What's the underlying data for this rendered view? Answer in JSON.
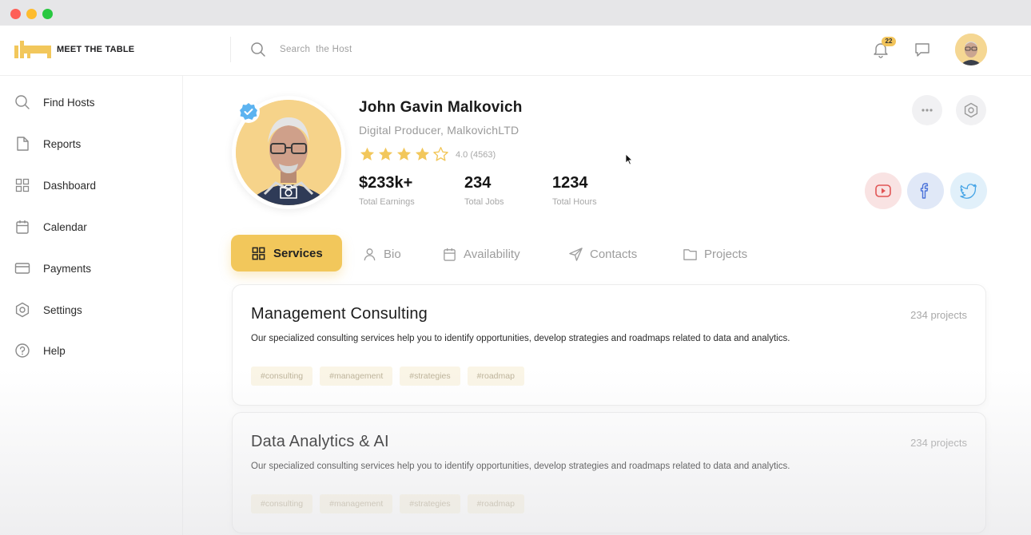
{
  "app": {
    "name": "MEET THE TABLE"
  },
  "search": {
    "placeholder": "Search  the Host"
  },
  "notifications": {
    "count": "22"
  },
  "sidebar": {
    "items": [
      {
        "label": "Find Hosts",
        "icon": "search-icon"
      },
      {
        "label": "Reports",
        "icon": "document-icon"
      },
      {
        "label": "Dashboard",
        "icon": "grid-icon"
      },
      {
        "label": "Calendar",
        "icon": "calendar-icon"
      },
      {
        "label": "Payments",
        "icon": "card-icon"
      },
      {
        "label": "Settings",
        "icon": "gear-icon"
      },
      {
        "label": "Help",
        "icon": "help-icon"
      }
    ]
  },
  "profile": {
    "name": "John Gavin Malkovich",
    "role": "Digital Producer, MalkovichLTD",
    "rating": 4.0,
    "rating_text": "4.0 (4563)",
    "stats": [
      {
        "value": "$233k+",
        "label": "Total Earnings"
      },
      {
        "value": "234",
        "label": "Total Jobs"
      },
      {
        "value": "1234",
        "label": "Total Hours"
      }
    ]
  },
  "colors": {
    "accent": "#f2c75b",
    "youtube": "#f9e3e3",
    "facebook": "#e0e8f7",
    "twitter": "#e1f0fa"
  },
  "tabs": [
    {
      "label": "Services",
      "icon": "grid-icon",
      "active": true
    },
    {
      "label": "Bio",
      "icon": "user-icon"
    },
    {
      "label": "Availability",
      "icon": "calendar-icon"
    },
    {
      "label": "Contacts",
      "icon": "send-icon"
    },
    {
      "label": "Projects",
      "icon": "folder-icon"
    }
  ],
  "services": [
    {
      "title": "Management Consulting",
      "count": "234 projects",
      "description": "Our specialized consulting services help you to identify opportunities, develop strategies and roadmaps related to data and analytics.",
      "tags": [
        "#consulting",
        "#management",
        "#strategies",
        "#roadmap"
      ]
    },
    {
      "title": "Data Analytics & AI",
      "count": "234 projects",
      "description": "Our specialized consulting services help you to identify opportunities, develop strategies and roadmaps related to data and analytics.",
      "tags": [
        "#consulting",
        "#management",
        "#strategies",
        "#roadmap"
      ]
    }
  ]
}
